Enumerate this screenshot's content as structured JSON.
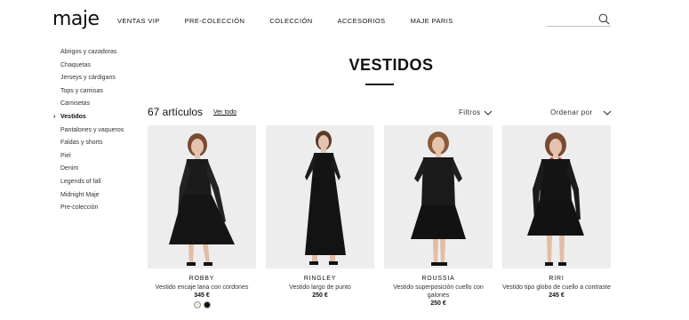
{
  "header": {
    "logo": "maje",
    "nav": [
      "VENTAS VIP",
      "PRE-COLECCIÓN",
      "COLECCIÓN",
      "ACCESORIOS",
      "MAJE PARIS"
    ],
    "search": {
      "value": "",
      "placeholder": "",
      "icon": "search-icon"
    }
  },
  "sidebar": {
    "items": [
      {
        "label": "Abrigos y cazadoras",
        "active": false
      },
      {
        "label": "Chaquetas",
        "active": false
      },
      {
        "label": "Jerseys y cárdigans",
        "active": false
      },
      {
        "label": "Tops y camisas",
        "active": false
      },
      {
        "label": "Camisetas",
        "active": false
      },
      {
        "label": "Vestidos",
        "active": true
      },
      {
        "label": "Pantalones y vaqueros",
        "active": false
      },
      {
        "label": "Faldas y shorts",
        "active": false
      },
      {
        "label": "Piel",
        "active": false
      },
      {
        "label": "Denim",
        "active": false
      },
      {
        "label": "Legends of fall",
        "active": false
      },
      {
        "label": "Midnight Maje",
        "active": false
      },
      {
        "label": "Pre-colección",
        "active": false
      }
    ],
    "active_marker": "›"
  },
  "main": {
    "title": "VESTIDOS",
    "count": "67 artículos",
    "view_all": "Ver todo",
    "filters_label": "Filtros",
    "sort_label": "Ordenar por"
  },
  "products": [
    {
      "name": "ROBBY",
      "desc": "Vestido encaje lana con cordones",
      "price": "345 €",
      "swatches": [
        "#f3ecd9",
        "#111111"
      ]
    },
    {
      "name": "RINGLEY",
      "desc": "Vestido largo de punto",
      "price": "250 €",
      "swatches": []
    },
    {
      "name": "ROUSSIA",
      "desc": "Vestido superposición cuello con galones",
      "price": "250 €",
      "swatches": []
    },
    {
      "name": "RIRI",
      "desc": "Vestido tipo globo de cuello a contraste",
      "price": "245 €",
      "swatches": []
    }
  ],
  "colors": {
    "text": "#111111",
    "muted": "#333333",
    "image_bg": "#ededed",
    "collar_accent": "#d0342c"
  }
}
